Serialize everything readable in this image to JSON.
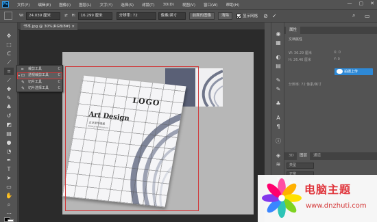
{
  "app": {
    "logo": "Ps"
  },
  "menu": [
    "文件(F)",
    "编辑(E)",
    "图像(I)",
    "图层(L)",
    "文字(Y)",
    "选择(S)",
    "滤镜(T)",
    "3D(D)",
    "视图(V)",
    "窗口(W)",
    "帮助(H)"
  ],
  "window_controls": {
    "minimize": "—",
    "maximize": "▢",
    "close": "✕"
  },
  "options": {
    "w_label": "W:",
    "w_value": "24.039 厘米",
    "swap": "⇄",
    "h_label": "H:",
    "h_value": "16.299 厘米",
    "resolution_value": "分辨率: 72",
    "unit_value": "像素/英寸",
    "front_image": "前面的图像",
    "clear": "清除",
    "grid_label": "显示网格",
    "cancel_icon": "⊘",
    "confirm_icon": "✓",
    "search_icon": "⌕",
    "workspace_icon": "▭"
  },
  "document": {
    "tab_label": "书本.jpg @ 30%(RGB/8#) ×"
  },
  "flyout": {
    "items": [
      {
        "label": "裁剪工具",
        "key": "C",
        "icon": "⌗"
      },
      {
        "label": "透视裁剪工具",
        "key": "C",
        "icon": "⊡"
      },
      {
        "label": "切片工具",
        "key": "C",
        "icon": "✎"
      },
      {
        "label": "切片选择工具",
        "key": "C",
        "icon": "✎"
      }
    ],
    "active_bullet": "•"
  },
  "book": {
    "logo": "LOGO",
    "title": "Art Design",
    "subtitle": "企业宣传画册",
    "subtitle2": "Enterprise Brochure"
  },
  "panel": {
    "properties_tab": "属性",
    "doc_props": "文档属性",
    "w_line": "W: 36.29 厘米",
    "x_line": "X: 0",
    "h_line": "H: 26.46 厘米",
    "y_line": "Y: 0",
    "resolution_line": "分辨率: 72 像素/英寸",
    "upload_label": "拍摄上传",
    "layers_tabs": [
      "3D",
      "图层",
      "通道"
    ],
    "layer_rows": [
      "类型",
      "正常",
      "锁定"
    ]
  },
  "watermark": {
    "title": "电脑主题",
    "url": "www.dnzhuti.com"
  },
  "colors": {
    "accent": "#2e89d6",
    "crop": "#d0393a",
    "watermark_red": "#e0343b",
    "bg": "#535353"
  }
}
